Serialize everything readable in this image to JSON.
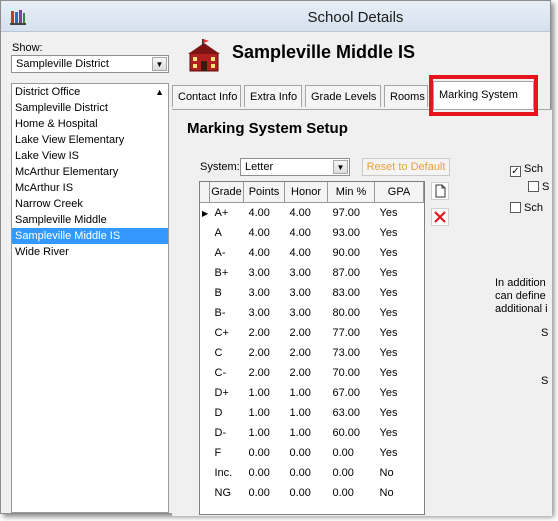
{
  "window": {
    "title": "School Details"
  },
  "sidebar": {
    "show_label": "Show:",
    "show_value": "Sampleville District",
    "items": [
      {
        "label": "District Office",
        "selected": false
      },
      {
        "label": "Sampleville District",
        "selected": false
      },
      {
        "label": "Home & Hospital",
        "selected": false
      },
      {
        "label": "Lake View Elementary",
        "selected": false
      },
      {
        "label": "Lake View IS",
        "selected": false
      },
      {
        "label": "McArthur Elementary",
        "selected": false
      },
      {
        "label": "McArthur IS",
        "selected": false
      },
      {
        "label": "Narrow Creek",
        "selected": false
      },
      {
        "label": "Sampleville Middle",
        "selected": false
      },
      {
        "label": "Sampleville Middle IS",
        "selected": true
      },
      {
        "label": "Wide River",
        "selected": false
      }
    ]
  },
  "header": {
    "school_name": "Sampleville Middle IS"
  },
  "tabs": [
    {
      "label": "Contact Info"
    },
    {
      "label": "Extra Info"
    },
    {
      "label": "Grade Levels"
    },
    {
      "label": "Rooms"
    },
    {
      "label": "Marking System"
    }
  ],
  "marking": {
    "title": "Marking System Setup",
    "system_label": "System:",
    "system_value": "Letter",
    "reset_label": "Reset to Default",
    "columns": [
      "Grade",
      "Points",
      "Honor",
      "Min %",
      "GPA"
    ],
    "rows": [
      [
        "A+",
        "4.00",
        "4.00",
        "97.00",
        "Yes"
      ],
      [
        "A",
        "4.00",
        "4.00",
        "93.00",
        "Yes"
      ],
      [
        "A-",
        "4.00",
        "4.00",
        "90.00",
        "Yes"
      ],
      [
        "B+",
        "3.00",
        "3.00",
        "87.00",
        "Yes"
      ],
      [
        "B",
        "3.00",
        "3.00",
        "83.00",
        "Yes"
      ],
      [
        "B-",
        "3.00",
        "3.00",
        "80.00",
        "Yes"
      ],
      [
        "C+",
        "2.00",
        "2.00",
        "77.00",
        "Yes"
      ],
      [
        "C",
        "2.00",
        "2.00",
        "73.00",
        "Yes"
      ],
      [
        "C-",
        "2.00",
        "2.00",
        "70.00",
        "Yes"
      ],
      [
        "D+",
        "1.00",
        "1.00",
        "67.00",
        "Yes"
      ],
      [
        "D",
        "1.00",
        "1.00",
        "63.00",
        "Yes"
      ],
      [
        "D-",
        "1.00",
        "1.00",
        "60.00",
        "Yes"
      ],
      [
        "F",
        "0.00",
        "0.00",
        "0.00",
        "Yes"
      ],
      [
        "Inc.",
        "0.00",
        "0.00",
        "0.00",
        "No"
      ],
      [
        "NG",
        "0.00",
        "0.00",
        "0.00",
        "No"
      ]
    ],
    "options": {
      "opt1": {
        "label": "Sch",
        "checked": true
      },
      "opt2": {
        "label": "S",
        "checked": false
      },
      "opt3": {
        "label": "Sch",
        "checked": false
      }
    },
    "note_lines": [
      "In addition",
      "can define",
      "additional i"
    ],
    "s1": "S",
    "s2": "S"
  },
  "colors": {
    "highlight": "#e8141b",
    "selection": "#3399ff",
    "reset_text": "#e8a13a"
  }
}
